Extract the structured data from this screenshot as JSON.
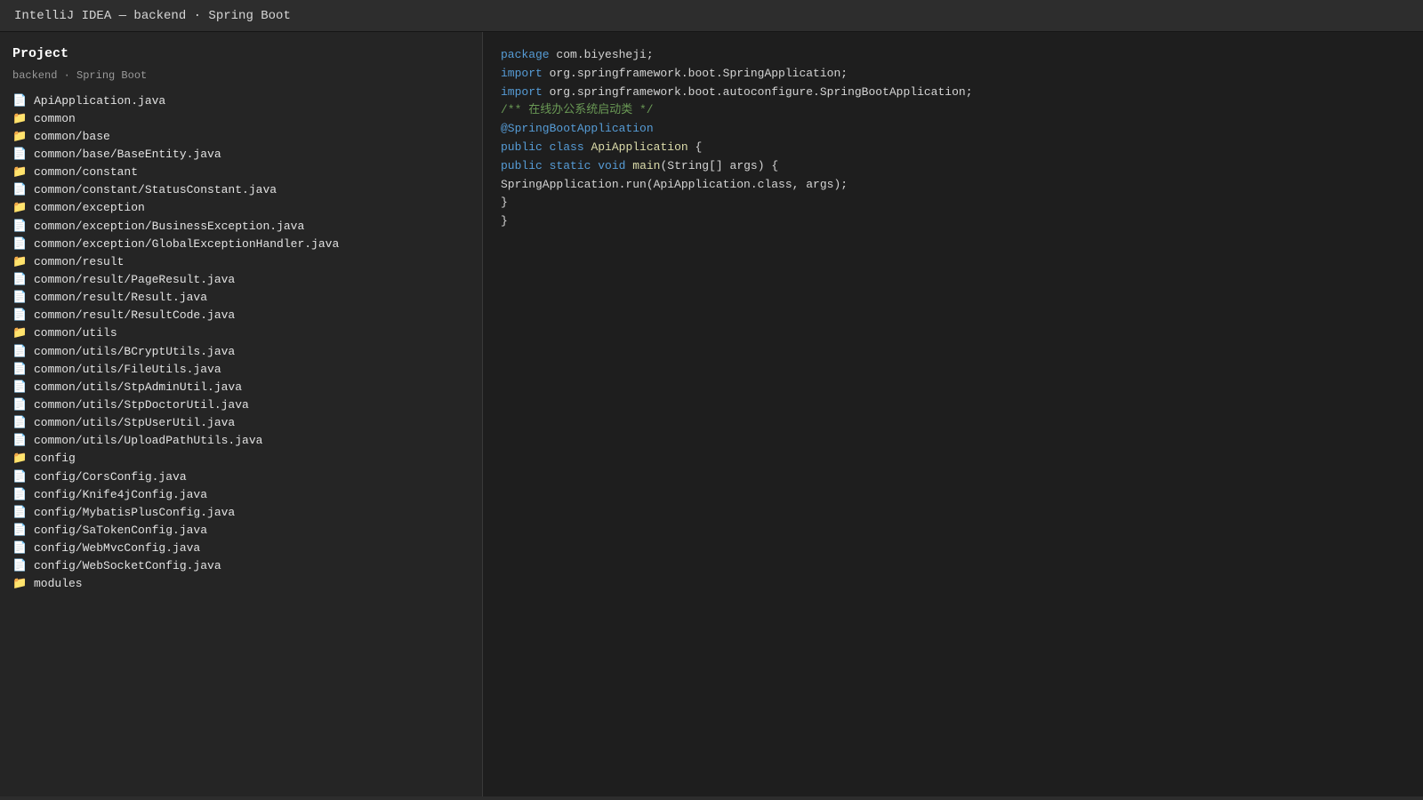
{
  "window": {
    "title": "IntelliJ IDEA — backend · Spring Boot"
  },
  "sidebar": {
    "title": "Project",
    "subtitle": "backend · Spring Boot",
    "items": [
      {
        "type": "file",
        "label": "ApiApplication.java"
      },
      {
        "type": "folder",
        "label": "common"
      },
      {
        "type": "folder",
        "label": "common/base"
      },
      {
        "type": "file",
        "label": "common/base/BaseEntity.java"
      },
      {
        "type": "folder",
        "label": "common/constant"
      },
      {
        "type": "file",
        "label": "common/constant/StatusConstant.java"
      },
      {
        "type": "folder",
        "label": "common/exception"
      },
      {
        "type": "file",
        "label": "common/exception/BusinessException.java"
      },
      {
        "type": "file",
        "label": "common/exception/GlobalExceptionHandler.java"
      },
      {
        "type": "folder",
        "label": "common/result"
      },
      {
        "type": "file",
        "label": "common/result/PageResult.java"
      },
      {
        "type": "file",
        "label": "common/result/Result.java"
      },
      {
        "type": "file",
        "label": "common/result/ResultCode.java"
      },
      {
        "type": "folder",
        "label": "common/utils"
      },
      {
        "type": "file",
        "label": "common/utils/BCryptUtils.java"
      },
      {
        "type": "file",
        "label": "common/utils/FileUtils.java"
      },
      {
        "type": "file",
        "label": "common/utils/StpAdminUtil.java"
      },
      {
        "type": "file",
        "label": "common/utils/StpDoctorUtil.java"
      },
      {
        "type": "file",
        "label": "common/utils/StpUserUtil.java"
      },
      {
        "type": "file",
        "label": "common/utils/UploadPathUtils.java"
      },
      {
        "type": "folder",
        "label": "config"
      },
      {
        "type": "file",
        "label": "config/CorsConfig.java"
      },
      {
        "type": "file",
        "label": "config/Knife4jConfig.java"
      },
      {
        "type": "file",
        "label": "config/MybatisPlusConfig.java"
      },
      {
        "type": "file",
        "label": "config/SaTokenConfig.java"
      },
      {
        "type": "file",
        "label": "config/WebMvcConfig.java"
      },
      {
        "type": "file",
        "label": "config/WebSocketConfig.java"
      },
      {
        "type": "folder",
        "label": "modules"
      }
    ]
  },
  "editor": {
    "lines": [
      [
        {
          "t": "kw",
          "v": "package"
        },
        {
          "t": "plain",
          "v": " com.biyesheji;"
        }
      ],
      [
        {
          "t": "kw",
          "v": "import"
        },
        {
          "t": "plain",
          "v": " org.springframework.boot.SpringApplication;"
        }
      ],
      [
        {
          "t": "kw",
          "v": "import"
        },
        {
          "t": "plain",
          "v": " org.springframework.boot.autoconfigure.SpringBootApplication;"
        }
      ],
      [
        {
          "t": "cm",
          "v": "/** 在线办公系统启动类 */"
        }
      ],
      [
        {
          "t": "an",
          "v": "@SpringBootApplication"
        }
      ],
      [
        {
          "t": "kw",
          "v": "public"
        },
        {
          "t": "plain",
          "v": " "
        },
        {
          "t": "kw",
          "v": "class"
        },
        {
          "t": "plain",
          "v": " "
        },
        {
          "t": "cls",
          "v": "ApiApplication"
        },
        {
          "t": "plain",
          "v": " {"
        }
      ],
      [
        {
          "t": "kw",
          "v": "public"
        },
        {
          "t": "plain",
          "v": " "
        },
        {
          "t": "kw",
          "v": "static"
        },
        {
          "t": "plain",
          "v": " "
        },
        {
          "t": "kw",
          "v": "void"
        },
        {
          "t": "plain",
          "v": " "
        },
        {
          "t": "fn",
          "v": "main"
        },
        {
          "t": "plain",
          "v": "(String[] args) {"
        }
      ],
      [
        {
          "t": "plain",
          "v": "SpringApplication.run(ApiApplication.class, args);"
        }
      ],
      [
        {
          "t": "plain",
          "v": "}"
        }
      ],
      [
        {
          "t": "plain",
          "v": "}"
        }
      ]
    ]
  },
  "icons": {
    "file": "file-icon",
    "folder": "folder-icon"
  },
  "colors": {
    "keyword": "#569cd6",
    "comment": "#6a9955",
    "class_name": "#dcdcaa",
    "text": "#d4d4d4",
    "folder": "#e8b84a"
  }
}
